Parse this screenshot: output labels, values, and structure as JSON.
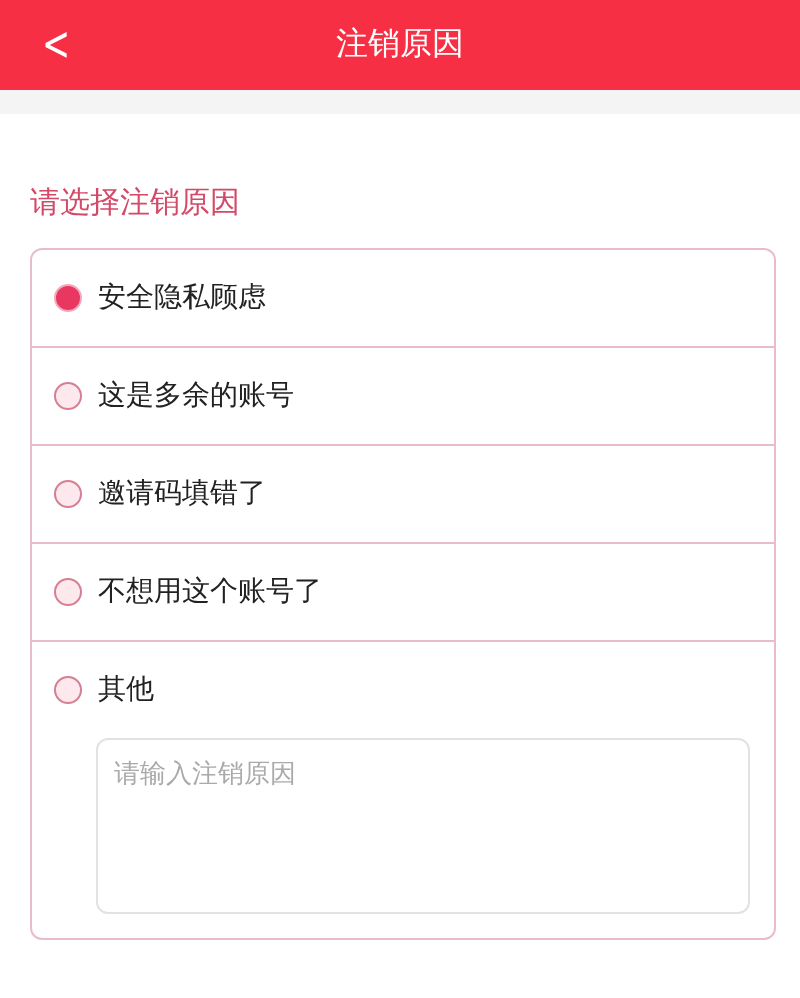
{
  "header": {
    "back": "<",
    "title": "注销原因"
  },
  "section_title": "请选择注销原因",
  "reasons": [
    {
      "label": "安全隐私顾虑",
      "selected": true
    },
    {
      "label": "这是多余的账号",
      "selected": false
    },
    {
      "label": "邀请码填错了",
      "selected": false
    },
    {
      "label": "不想用这个账号了",
      "selected": false
    },
    {
      "label": "其他",
      "selected": false
    }
  ],
  "reason_field": {
    "placeholder": "请输入注销原因"
  }
}
